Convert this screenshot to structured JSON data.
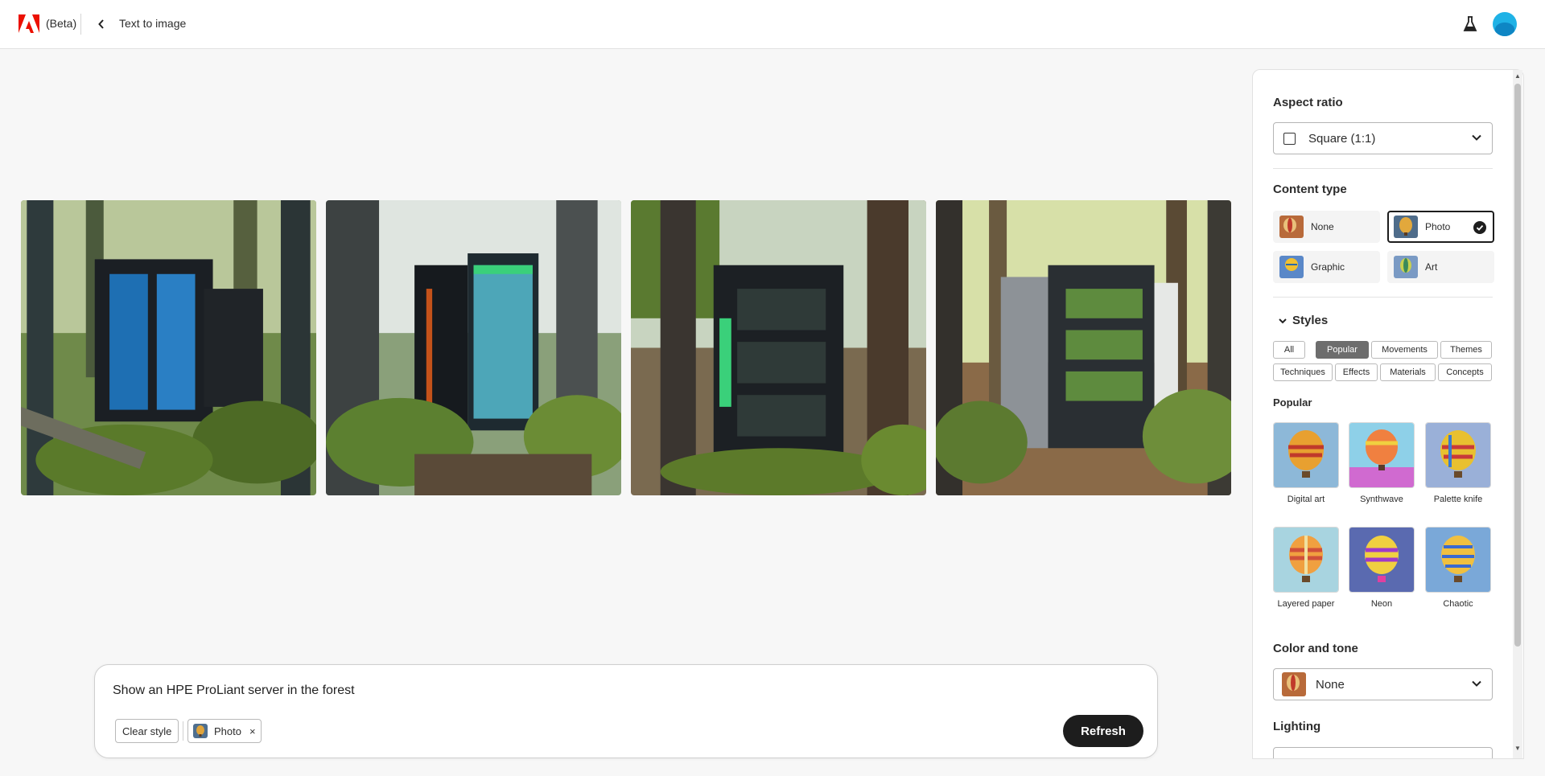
{
  "header": {
    "beta_label": "(Beta)",
    "breadcrumb": "Text to image",
    "brand_color": "#eb1000"
  },
  "prompt": {
    "text": "Show an HPE ProLiant server in the forest",
    "clear_style_label": "Clear style",
    "applied_style_chip": "Photo",
    "remove_chip_glyph": "×",
    "refresh_label": "Refresh"
  },
  "panel": {
    "aspect_ratio": {
      "title": "Aspect ratio",
      "selected": "Square (1:1)"
    },
    "content_type": {
      "title": "Content type",
      "options": [
        "None",
        "Photo",
        "Graphic",
        "Art"
      ],
      "selected": "Photo"
    },
    "styles": {
      "title": "Styles",
      "tags_row1": [
        "All",
        "Popular",
        "Movements",
        "Themes"
      ],
      "tags_row2": [
        "Techniques",
        "Effects",
        "Materials",
        "Concepts"
      ],
      "active_tag": "Popular",
      "section_label": "Popular",
      "items": [
        "Digital art",
        "Synthwave",
        "Palette knife",
        "Layered paper",
        "Neon",
        "Chaotic"
      ]
    },
    "color_and_tone": {
      "title": "Color and tone",
      "selected": "None"
    },
    "lighting": {
      "title": "Lighting"
    }
  }
}
